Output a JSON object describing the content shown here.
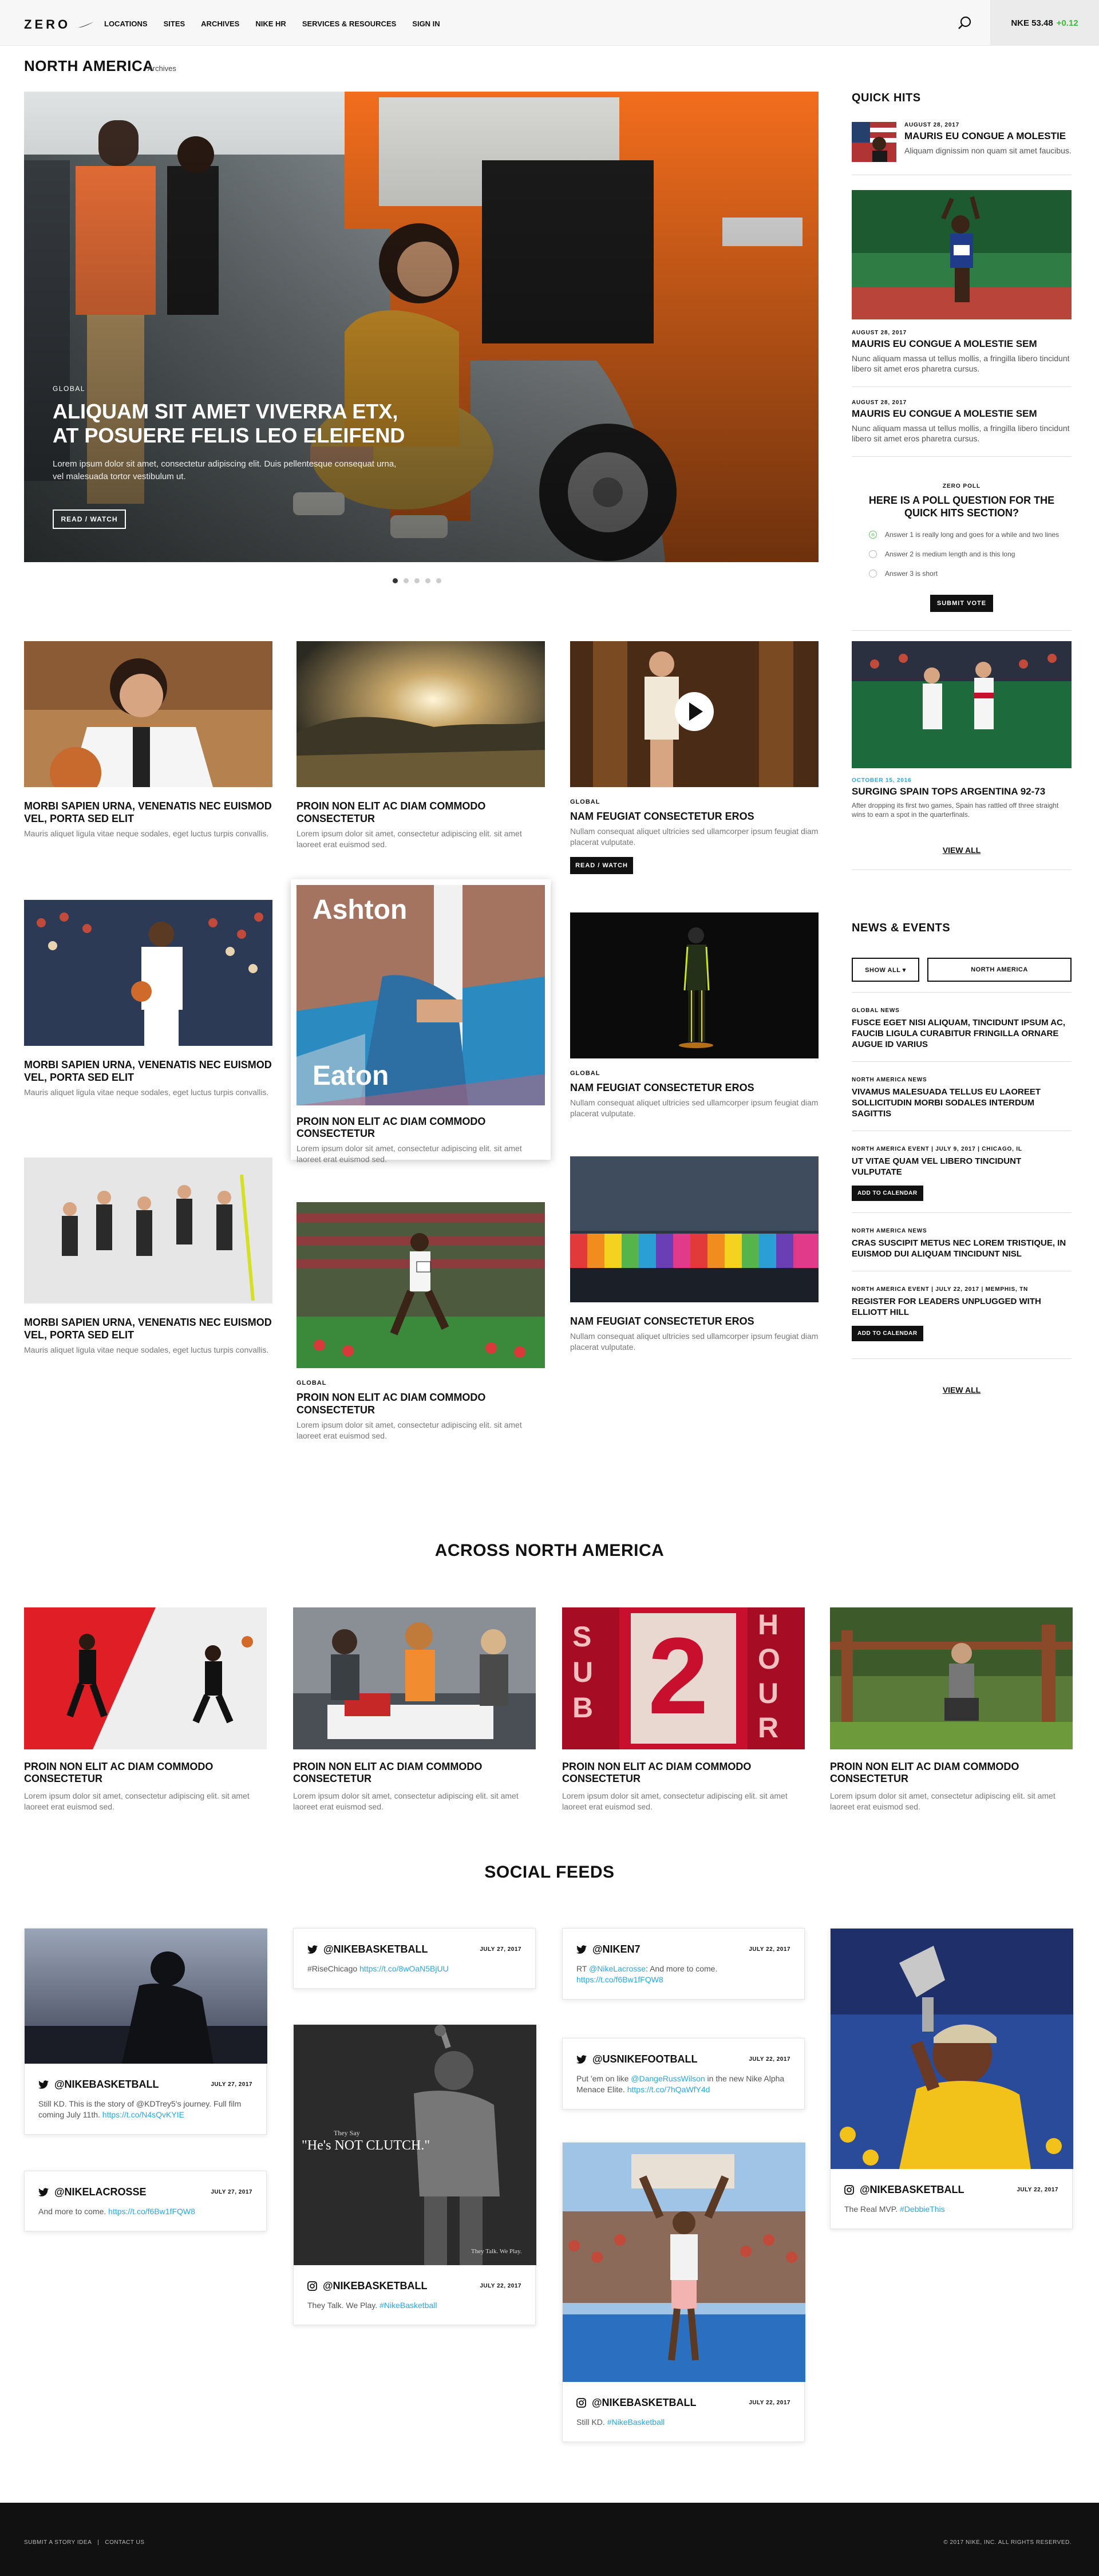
{
  "brand": {
    "logo_text": "ZERO",
    "accent": "#3cb93c",
    "link": "#2aa7df"
  },
  "nav": {
    "links": [
      "LOCATIONS",
      "SITES",
      "ARCHIVES",
      "NIKE HR",
      "SERVICES & RESOURCES",
      "SIGN IN"
    ],
    "ticker_symbol": "NKE 53.48",
    "ticker_change": "+0.12"
  },
  "section": {
    "title": "NORTH AMERICA",
    "archives": "Archives"
  },
  "hero": {
    "category": "GLOBAL",
    "headline": "ALIQUAM SIT AMET VIVERRA ETX, AT POSUERE FELIS LEO ELEIFEND",
    "body": "Lorem ipsum dolor sit amet, consectetur adipiscing elit. Duis pellentesque consequat urna, vel malesuada tortor vestibulum ut.",
    "button": "READ / WATCH",
    "slide_count": 5,
    "active_slide": 1
  },
  "cards": [
    {
      "title": "MORBI SAPIEN URNA, VENENATIS NEC EUISMOD VEL, PORTA SED ELIT",
      "body": "Mauris aliquet ligula vitae neque sodales, eget luctus turpis convallis."
    },
    {
      "title": "PROIN NON ELIT AC DIAM COMMODO CONSECTETUR",
      "body": "Lorem ipsum dolor sit amet, consectetur adipiscing elit. sit amet laoreet erat euismod sed."
    },
    {
      "category": "GLOBAL",
      "title": "NAM FEUGIAT CONSECTETUR EROS",
      "body": "Nullam consequat aliquet ultricies sed ullamcorper ipsum feugiat diam placerat vulputate.",
      "button": "READ / WATCH"
    },
    {
      "title": "MORBI SAPIEN URNA, VENENATIS NEC EUISMOD VEL, PORTA SED ELIT",
      "body": "Mauris aliquet ligula vitae neque sodales, eget luctus turpis convallis."
    },
    {
      "overlay_top": "Ashton",
      "overlay_bottom": "Eaton",
      "title": "PROIN NON ELIT AC DIAM COMMODO CONSECTETUR",
      "body": "Lorem ipsum dolor sit amet, consectetur adipiscing elit. sit amet laoreet erat euismod sed."
    },
    {
      "category": "GLOBAL",
      "title": "NAM FEUGIAT CONSECTETUR EROS",
      "body": "Nullam consequat aliquet ultricies sed ullamcorper ipsum feugiat diam placerat vulputate."
    },
    {
      "title": "MORBI SAPIEN URNA, VENENATIS NEC EUISMOD VEL, PORTA SED ELIT",
      "body": "Mauris aliquet ligula vitae neque sodales, eget luctus turpis convallis."
    },
    {
      "title": "NAM FEUGIAT CONSECTETUR EROS",
      "body": "Nullam consequat aliquet ultricies sed ullamcorper ipsum feugiat diam placerat vulputate."
    },
    {
      "category": "GLOBAL",
      "title": "PROIN NON ELIT AC DIAM COMMODO CONSECTETUR",
      "body": "Lorem ipsum dolor sit amet, consectetur adipiscing elit. sit amet laoreet erat euismod sed."
    }
  ],
  "quick_hits": {
    "heading": "QUICK HITS",
    "items": [
      {
        "date": "AUGUST 28, 2017",
        "title": "MAURIS EU CONGUE A MOLESTIE",
        "body": "Aliquam dignissim non quam sit amet faucibus."
      },
      {
        "date": "AUGUST 28, 2017",
        "title": "MAURIS EU CONGUE A MOLESTIE SEM",
        "body": "Nunc aliquam massa ut tellus mollis, a fringilla libero tincidunt libero sit amet eros pharetra cursus."
      },
      {
        "date": "AUGUST 28, 2017",
        "title": "MAURIS EU CONGUE A MOLESTIE SEM",
        "body": "Nunc aliquam massa ut tellus mollis, a fringilla libero tincidunt libero sit amet eros pharetra cursus."
      }
    ],
    "poll": {
      "label": "ZERO POLL",
      "question": "HERE IS A POLL QUESTION FOR THE QUICK HITS SECTION?",
      "options": [
        "Answer 1 is really long and goes for a while and two lines",
        "Answer 2 is medium length and is this long",
        "Answer 3 is short"
      ],
      "submit": "SUBMIT VOTE"
    },
    "story": {
      "date": "OCTOBER 15, 2016",
      "title": "SURGING SPAIN TOPS ARGENTINA 92-73",
      "body": "After dropping its first two games, Spain has rattled off three straight wins to earn a spot in the quarterfinals."
    },
    "view_all": "VIEW ALL"
  },
  "news_events": {
    "heading": "NEWS & EVENTS",
    "filter_show": "SHOW ALL ▾",
    "filter_region": "NORTH AMERICA",
    "items": [
      {
        "tag": "GLOBAL NEWS",
        "title": "FUSCE EGET NISI ALIQUAM, TINCIDUNT IPSUM AC, FAUCIB LIGULA CURABITUR FRINGILLA ORNARE AUGUE ID VARIUS"
      },
      {
        "tag": "NORTH AMERICA NEWS",
        "title": "VIVAMUS MALESUADA TELLUS EU LAOREET SOLLICITUDIN MORBI SODALES INTERDUM SAGITTIS"
      },
      {
        "tag": "NORTH AMERICA EVENT  |  JULY 9, 2017  |  CHICAGO, IL",
        "title": "UT VITAE QUAM VEL LIBERO TINCIDUNT VULPUTATE",
        "button": "ADD TO CALENDAR"
      },
      {
        "tag": "NORTH AMERICA NEWS",
        "title": "CRAS SUSCIPIT METUS NEC LOREM TRISTIQUE, IN EUISMOD DUI ALIQUAM TINCIDUNT NISL"
      },
      {
        "tag": "NORTH AMERICA EVENT  |  JULY 22, 2017  |  MEMPHIS, TN",
        "title": "REGISTER FOR LEADERS UNPLUGGED WITH ELLIOTT HILL",
        "button": "ADD TO CALENDAR"
      }
    ],
    "view_all": "VIEW ALL"
  },
  "across": {
    "heading": "ACROSS NORTH AMERICA",
    "cards": [
      {
        "title": "PROIN NON ELIT AC DIAM COMMODO CONSECTETUR",
        "body": "Lorem ipsum dolor sit amet, consectetur adipiscing elit. sit amet laoreet erat euismod sed."
      },
      {
        "title": "PROIN NON ELIT AC DIAM COMMODO CONSECTETUR",
        "body": "Lorem ipsum dolor sit amet, consectetur adipiscing elit. sit amet laoreet erat euismod sed."
      },
      {
        "title": "PROIN NON ELIT AC DIAM COMMODO CONSECTETUR",
        "body": "Lorem ipsum dolor sit amet, consectetur adipiscing elit. sit amet laoreet erat euismod sed.",
        "poster_left": "SUB",
        "poster_mid": "2",
        "poster_right": "HOUR"
      },
      {
        "title": "PROIN NON ELIT AC DIAM COMMODO CONSECTETUR",
        "body": "Lorem ipsum dolor sit amet, consectetur adipiscing elit. sit amet laoreet erat euismod sed."
      }
    ]
  },
  "social": {
    "heading": "SOCIAL FEEDS",
    "posts": [
      {
        "network": "twitter",
        "handle": "@NIKEBASKETBALL",
        "date": "JULY 27, 2017",
        "text": "Still KD. This is the story of @KDTrey5's journey. Full film coming July 11th. ",
        "link": "https://t.co/N4sQvKYIE"
      },
      {
        "network": "twitter",
        "handle": "@NIKELACROSSE",
        "date": "JULY 27, 2017",
        "text": "And more to come. ",
        "link": "https://t.co/f6Bw1fFQW8"
      },
      {
        "network": "twitter",
        "handle": "@NIKEBASKETBALL",
        "date": "JULY 27, 2017",
        "text": "#RiseChicago ",
        "link": "https://t.co/8wOaN5BjUU"
      },
      {
        "network": "instagram",
        "handle": "@NIKEBASKETBALL",
        "date": "JULY 22, 2017",
        "text": "They Talk. We Play. ",
        "link": "#NikeBasketball",
        "poster_small": "They Say",
        "poster_quote": "\"He's NOT CLUTCH.\"",
        "poster_tag": "They Talk. We Play."
      },
      {
        "network": "twitter",
        "handle": "@NIKEN7",
        "date": "JULY 22, 2017",
        "text": "RT ",
        "link": "@NikeLacrosse",
        "text2": ": And more to come. ",
        "link2": "https://t.co/f6Bw1fFQW8"
      },
      {
        "network": "twitter",
        "handle": "@USNIKEFOOTBALL",
        "date": "JULY 22, 2017",
        "text": "Put 'em on like ",
        "link": "@DangeRussWilson",
        "text2": " in the new Nike Alpha Menace Elite. ",
        "link2": "https://t.co/7hQaWfY4d"
      },
      {
        "network": "instagram",
        "handle": "@NIKEBASKETBALL",
        "date": "JULY 22, 2017",
        "text": "Still KD. ",
        "link": "#NikeBasketball"
      },
      {
        "network": "instagram",
        "handle": "@NIKEBASKETBALL",
        "date": "JULY 22, 2017",
        "text": "The Real MVP. ",
        "link": "#DebbieThis"
      }
    ]
  },
  "footer": {
    "submit": "SUBMIT A STORY IDEA",
    "sep": "|",
    "contact": "CONTACT US",
    "copyright": "© 2017 NIKE, INC. ALL RIGHTS RESERVED."
  }
}
